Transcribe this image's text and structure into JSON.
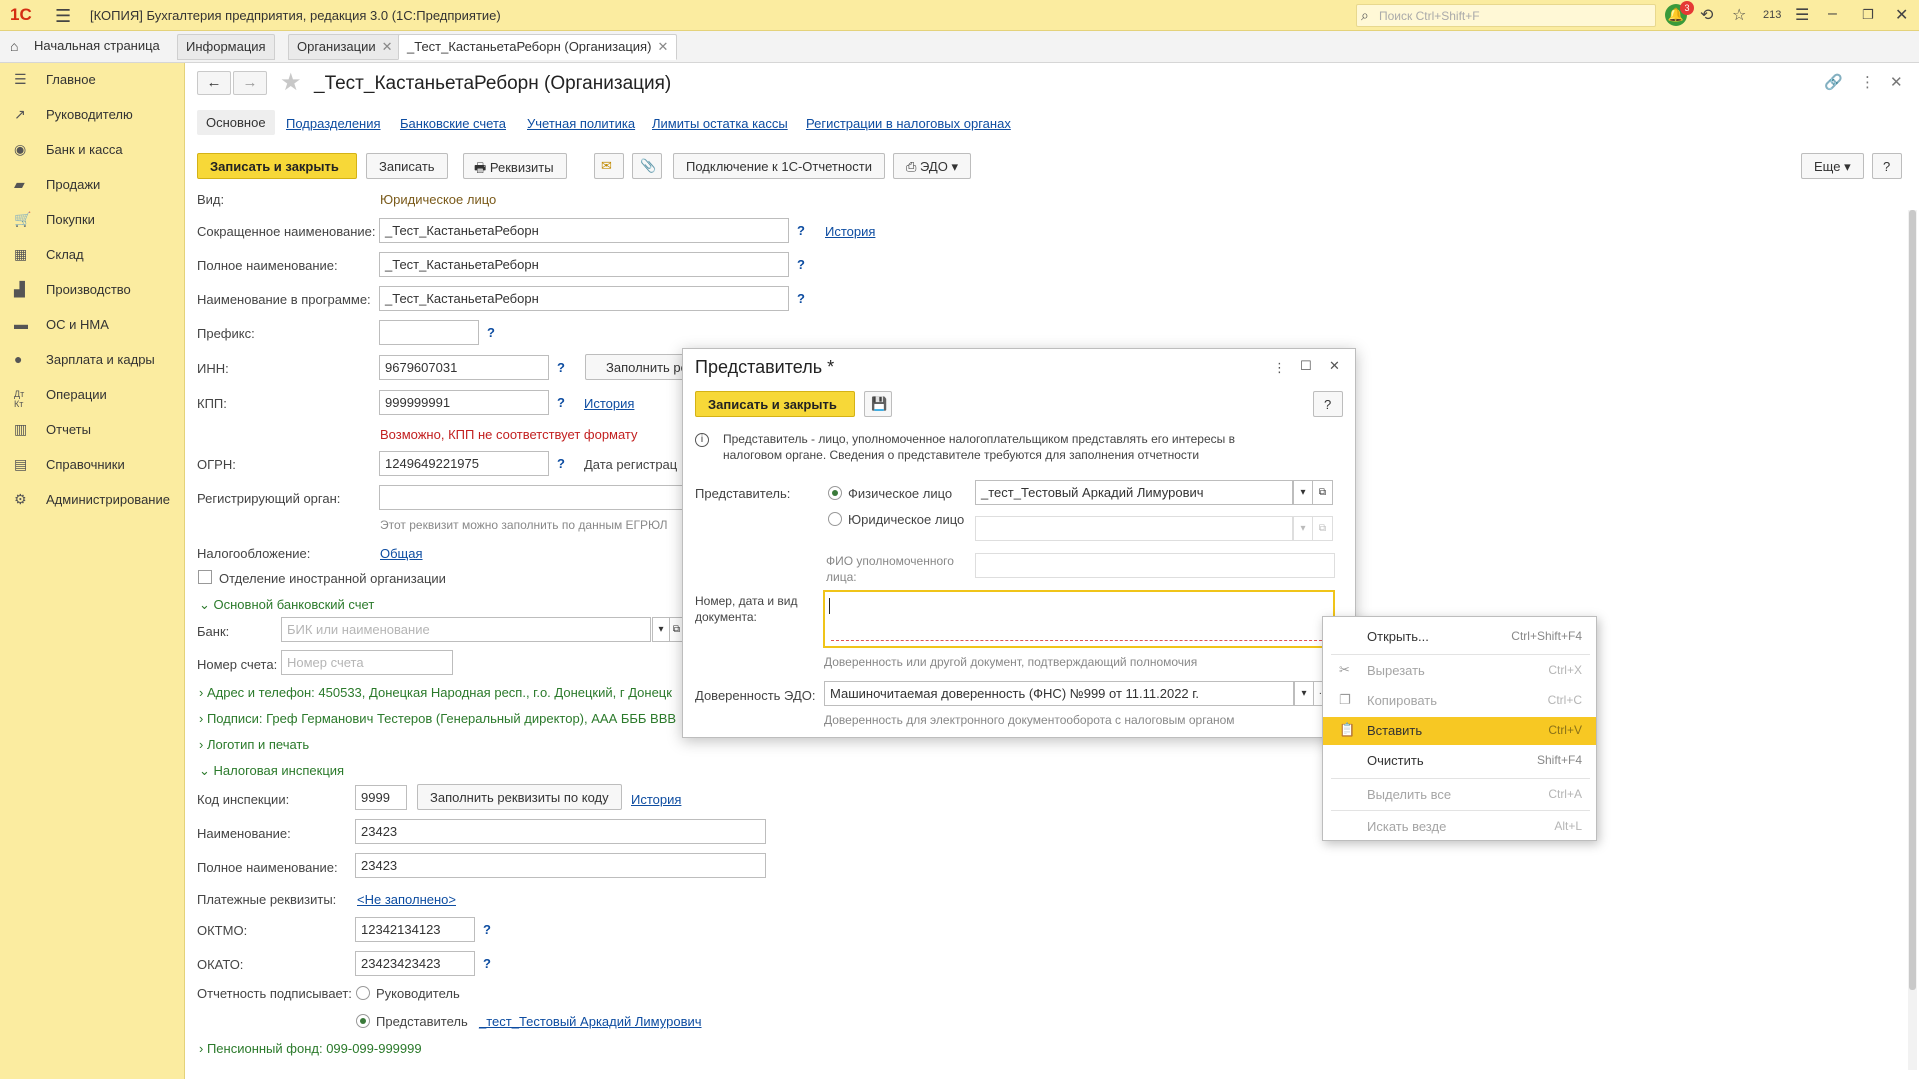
{
  "titlebar": {
    "logo": "1С",
    "title": "[КОПИЯ] Бухгалтерия предприятия, редакция 3.0  (1С:Предприятие)",
    "search_placeholder": "Поиск Ctrl+Shift+F",
    "notif_count": "3",
    "counter": "213"
  },
  "tabs": [
    {
      "label": "Начальная страница"
    },
    {
      "label": "Информация"
    },
    {
      "label": "Организации"
    },
    {
      "label": "_Тест_КастаньетаРеборн (Организация)"
    }
  ],
  "sidebar": {
    "items": [
      {
        "label": "Главное"
      },
      {
        "label": "Руководителю"
      },
      {
        "label": "Банк и касса"
      },
      {
        "label": "Продажи"
      },
      {
        "label": "Покупки"
      },
      {
        "label": "Склад"
      },
      {
        "label": "Производство"
      },
      {
        "label": "ОС и НМА"
      },
      {
        "label": "Зарплата и кадры"
      },
      {
        "label": "Операции"
      },
      {
        "label": "Отчеты"
      },
      {
        "label": "Справочники"
      },
      {
        "label": "Администрирование"
      }
    ]
  },
  "form": {
    "title": "_Тест_КастаньетаРеборн (Организация)",
    "subtabs": [
      "Основное",
      "Подразделения",
      "Банковские счета",
      "Учетная политика",
      "Лимиты остатка кассы",
      "Регистрации в налоговых органах"
    ],
    "toolbar": {
      "save_close": "Записать и закрыть",
      "save": "Записать",
      "requisites": "Реквизиты",
      "connect": "Подключение к 1С-Отчетности",
      "edo": "ЭДО",
      "more": "Еще",
      "help": "?"
    },
    "vid_label": "Вид:",
    "vid_value": "Юридическое лицо",
    "short_name_label": "Сокращенное наименование:",
    "short_name": "_Тест_КастаньетаРеборн",
    "full_name_label": "Полное наименование:",
    "full_name": "_Тест_КастаньетаРеборн",
    "prog_name_label": "Наименование в программе:",
    "prog_name": "_Тест_КастаньетаРеборн",
    "history": "История",
    "prefix_label": "Префикс:",
    "prefix": "",
    "inn_label": "ИНН:",
    "inn": "9679607031",
    "fill_btn": "Заполнить ре",
    "kpp_label": "КПП:",
    "kpp": "999999991",
    "kpp_warning": "Возможно, КПП не соответствует формату",
    "ogrn_label": "ОГРН:",
    "ogrn": "1249649221975",
    "reg_date_label": "Дата регистрац",
    "reg_organ_label": "Регистрирующий орган:",
    "egrul_hint": "Этот реквизит можно заполнить по данным ЕГРЮЛ",
    "tax_label": "Налогообложение:",
    "tax_value": "Общая",
    "foreign_label": "Отделение иностранной организации",
    "bank_section": "Основной банковский счет",
    "bank_label": "Банк:",
    "bank_placeholder": "БИК или наименование",
    "account_label": "Номер счета:",
    "account_placeholder": "Номер счета",
    "address": "Адрес и телефон: 450533, Донецкая Народная респ., г.о. Донецкий, г Донецк",
    "signatures": "Подписи: Греф Германович Тестеров (Генеральный директор), ААА БББ ВВВ",
    "logo_section": "Логотип и печать",
    "tax_inspection": "Налоговая инспекция",
    "code_label": "Код инспекции:",
    "code": "9999",
    "fill_by_code": "Заполнить реквизиты по коду",
    "insp_name_label": "Наименование:",
    "insp_name": "23423",
    "insp_full_label": "Полное наименование:",
    "insp_full": "23423",
    "pay_label": "Платежные реквизиты:",
    "pay_value": "<Не заполнено>",
    "oktmo_label": "ОКТМО:",
    "oktmo": "12342134123",
    "okato_label": "ОКАТО:",
    "okato": "23423423423",
    "signer_label": "Отчетность подписывает:",
    "signer_head": "Руководитель",
    "signer_rep": "Представитель",
    "signer_rep_value": "_тест_Тестовый Аркадий Лимурович",
    "pension": "Пенсионный фонд: 099-099-999999"
  },
  "dialog": {
    "title": "Представитель *",
    "save_close": "Записать и закрыть",
    "help": "?",
    "info": "Представитель - лицо, уполномоченное налогоплательщиком представлять его интересы в налоговом органе. Сведения о представителе требуются для заполнения отчетности",
    "rep_label": "Представитель:",
    "physical": "Физическое лицо",
    "legal": "Юридическое лицо",
    "physical_value": "_тест_Тестовый Аркадий Лимурович",
    "fio_label": "ФИО уполномоченного лица:",
    "doc_label": "Номер, дата и вид документа:",
    "doc_hint": "Доверенность или другой документ, подтверждающий полномочия",
    "edo_label": "Доверенность ЭДО:",
    "edo_value": "Машиночитаемая доверенность (ФНС) №999 от 11.11.2022 г.",
    "edo_hint": "Доверенность для электронного документооборота с налоговым органом"
  },
  "context_menu": {
    "items": [
      {
        "label": "Открыть...",
        "shortcut": "Ctrl+Shift+F4"
      },
      {
        "label": "Вырезать",
        "shortcut": "Ctrl+X"
      },
      {
        "label": "Копировать",
        "shortcut": "Ctrl+C"
      },
      {
        "label": "Вставить",
        "shortcut": "Ctrl+V"
      },
      {
        "label": "Очистить",
        "shortcut": "Shift+F4"
      },
      {
        "label": "Выделить все",
        "shortcut": "Ctrl+A"
      },
      {
        "label": "Искать везде",
        "shortcut": "Alt+L"
      }
    ]
  },
  "colors": {
    "accent": "#f7d838",
    "sidebar": "#fbeca0",
    "link": "#0e4da1",
    "section": "#2b7a2b",
    "warning": "#c21f1f"
  }
}
